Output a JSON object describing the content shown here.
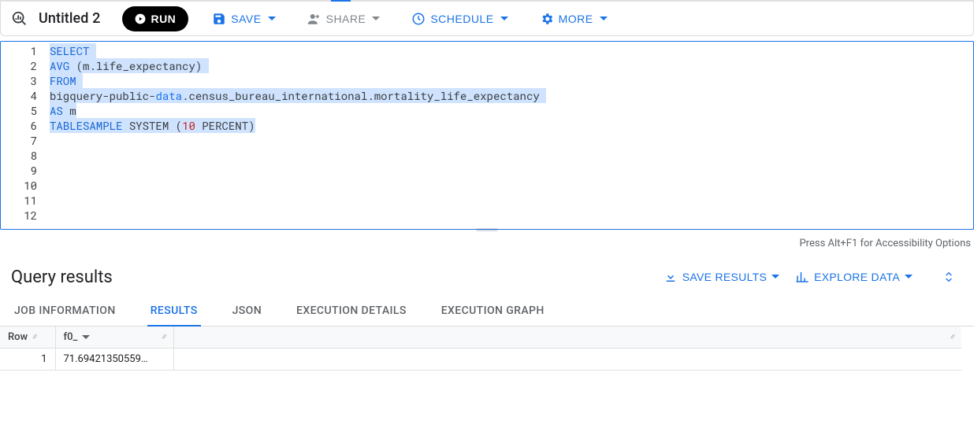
{
  "header": {
    "title": "Untitled 2",
    "run_label": "RUN",
    "save_label": "SAVE",
    "share_label": "SHARE",
    "schedule_label": "SCHEDULE",
    "more_label": "MORE"
  },
  "editor": {
    "line_numbers": [
      "1",
      "2",
      "3",
      "4",
      "5",
      "6",
      "7",
      "8",
      "9",
      "10",
      "11",
      "12"
    ],
    "lines": [
      {
        "segments": [
          {
            "t": "SELECT",
            "cls": "kw hl"
          },
          {
            "t": " ",
            "cls": "hl"
          }
        ]
      },
      {
        "segments": [
          {
            "t": "AVG",
            "cls": "fn hl"
          },
          {
            "t": " ",
            "cls": "hl"
          },
          {
            "t": "(",
            "cls": "paren hl"
          },
          {
            "t": "m",
            "cls": "ident hl"
          },
          {
            "t": ".",
            "cls": "dot hl"
          },
          {
            "t": "life_expectancy",
            "cls": "ident hl"
          },
          {
            "t": ")",
            "cls": "paren hl"
          },
          {
            "t": " ",
            "cls": "hl"
          }
        ]
      },
      {
        "segments": [
          {
            "t": "FROM",
            "cls": "kw hl"
          },
          {
            "t": " ",
            "cls": "hl"
          }
        ]
      },
      {
        "segments": [
          {
            "t": "bigquery",
            "cls": "ident hl"
          },
          {
            "t": "-",
            "cls": "plain hl"
          },
          {
            "t": "public",
            "cls": "ident hl"
          },
          {
            "t": "-",
            "cls": "plain hl"
          },
          {
            "t": "data",
            "cls": "light hl"
          },
          {
            "t": ".",
            "cls": "dot hl"
          },
          {
            "t": "census_bureau_international",
            "cls": "ident hl"
          },
          {
            "t": ".",
            "cls": "dot hl"
          },
          {
            "t": "mortality_life_expectancy",
            "cls": "ident hl"
          },
          {
            "t": " ",
            "cls": "hl"
          }
        ]
      },
      {
        "segments": [
          {
            "t": "AS",
            "cls": "kw hl"
          },
          {
            "t": " ",
            "cls": "hl"
          },
          {
            "t": "m",
            "cls": "ident hl"
          }
        ]
      },
      {
        "segments": [
          {
            "t": "TABLESAMPLE",
            "cls": "kw hl"
          },
          {
            "t": " ",
            "cls": "plain hl"
          },
          {
            "t": "SYSTEM",
            "cls": "ident hl"
          },
          {
            "t": " ",
            "cls": "plain hl"
          },
          {
            "t": "(",
            "cls": "paren hl"
          },
          {
            "t": "10",
            "cls": "num hl"
          },
          {
            "t": " ",
            "cls": "plain hl"
          },
          {
            "t": "PERCENT",
            "cls": "ident hl"
          },
          {
            "t": ")",
            "cls": "paren hl"
          }
        ]
      },
      {
        "segments": []
      },
      {
        "segments": []
      },
      {
        "segments": []
      },
      {
        "segments": []
      },
      {
        "segments": []
      },
      {
        "segments": []
      }
    ],
    "accessibility_hint": "Press Alt+F1 for Accessibility Options"
  },
  "results": {
    "title": "Query results",
    "save_results_label": "SAVE RESULTS",
    "explore_data_label": "EXPLORE DATA",
    "tabs": [
      "JOB INFORMATION",
      "RESULTS",
      "JSON",
      "EXECUTION DETAILS",
      "EXECUTION GRAPH"
    ],
    "active_tab_index": 1,
    "columns": [
      "Row",
      "f0_"
    ],
    "rows": [
      {
        "row": "1",
        "f0": "71.69421350559…"
      }
    ]
  }
}
